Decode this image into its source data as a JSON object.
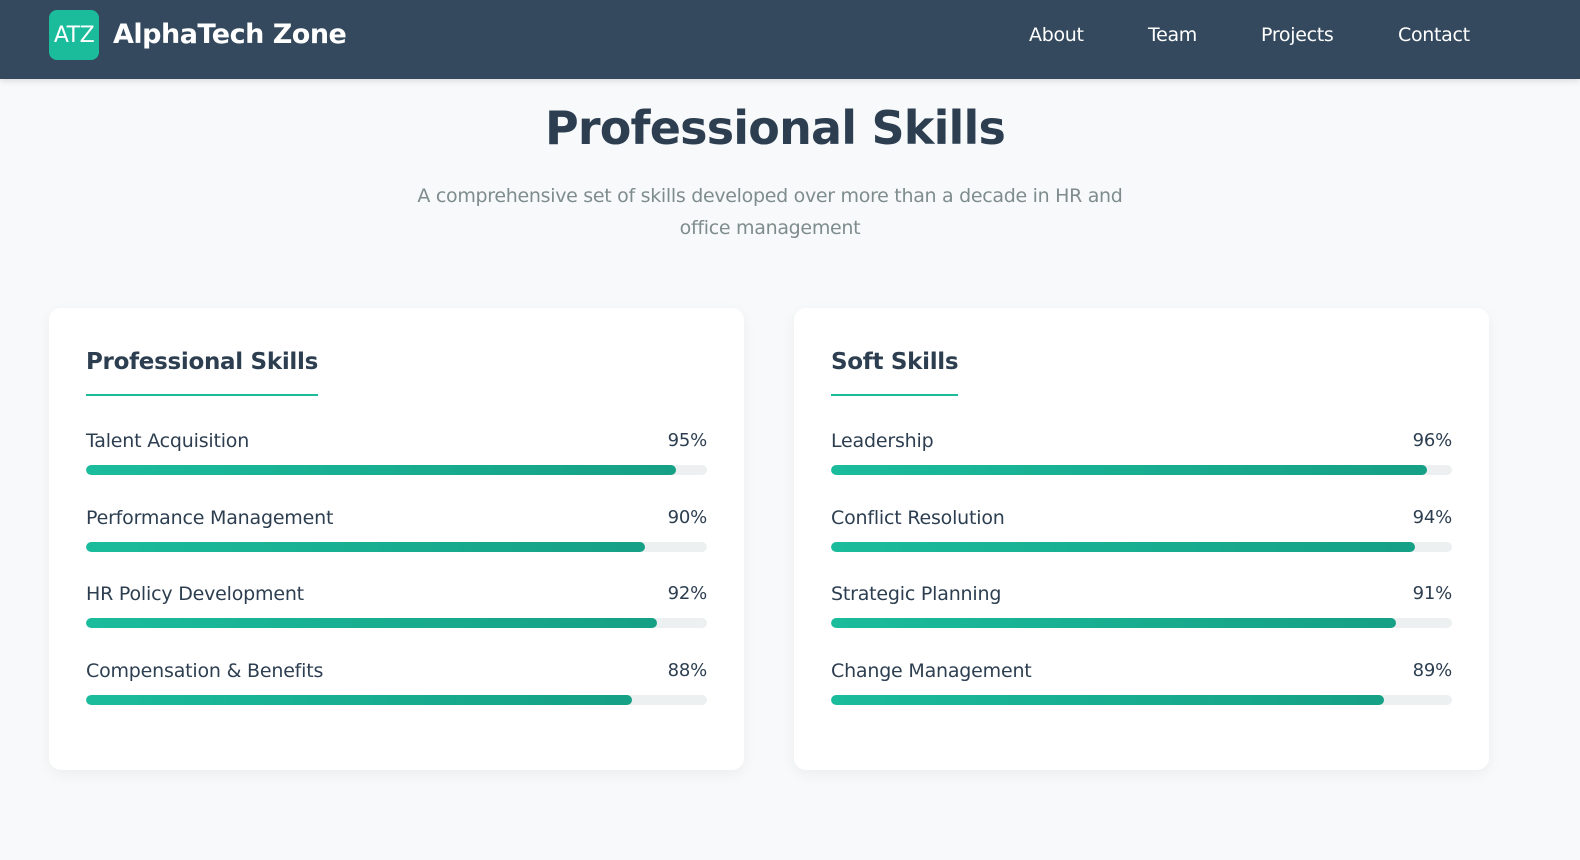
{
  "nav": {
    "logo_text": "ATZ",
    "brand_name": "AlphaTech Zone",
    "links": [
      "About",
      "Team",
      "Projects",
      "Contact"
    ]
  },
  "header": {
    "title": "Professional Skills",
    "subtitle": "A comprehensive set of skills developed over more than a decade in HR and office management"
  },
  "professional": {
    "title": "Professional Skills",
    "skills": [
      {
        "name": "Talent Acquisition",
        "percent_label": "95%",
        "value": 95
      },
      {
        "name": "Performance Management",
        "percent_label": "90%",
        "value": 90
      },
      {
        "name": "HR Policy Development",
        "percent_label": "92%",
        "value": 92
      },
      {
        "name": "Compensation & Benefits",
        "percent_label": "88%",
        "value": 88
      }
    ]
  },
  "soft": {
    "title": "Soft Skills",
    "skills": [
      {
        "name": "Leadership",
        "percent_label": "96%",
        "value": 96
      },
      {
        "name": "Conflict Resolution",
        "percent_label": "94%",
        "value": 94
      },
      {
        "name": "Strategic Planning",
        "percent_label": "91%",
        "value": 91
      },
      {
        "name": "Change Management",
        "percent_label": "89%",
        "value": 89
      }
    ]
  },
  "colors": {
    "nav_background": "#34495e",
    "accent": "#1abc9c",
    "accent_dark": "#16a085",
    "text_dark": "#2c3e50",
    "text_muted": "#7f8c8d",
    "track": "#ecf0f1"
  }
}
